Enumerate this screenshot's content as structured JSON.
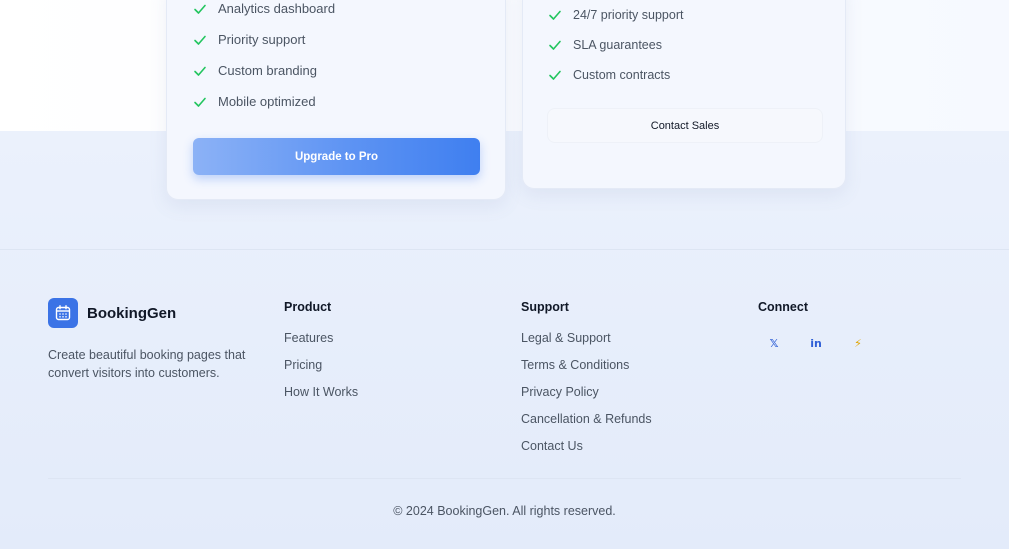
{
  "pricing": {
    "pro": {
      "features": [
        "Analytics dashboard",
        "Priority support",
        "Custom branding",
        "Mobile optimized"
      ],
      "cta_label": "Upgrade to Pro"
    },
    "enterprise": {
      "features": [
        "24/7 priority support",
        "SLA guarantees",
        "Custom contracts"
      ],
      "cta_label": "Contact Sales"
    }
  },
  "footer": {
    "brand_name": "BookingGen",
    "tagline": "Create beautiful booking pages that convert visitors into customers.",
    "product": {
      "title": "Product",
      "links": [
        "Features",
        "Pricing",
        "How It Works"
      ]
    },
    "support": {
      "title": "Support",
      "links": [
        "Legal & Support",
        "Terms & Conditions",
        "Privacy Policy",
        "Cancellation & Refunds",
        "Contact Us"
      ]
    },
    "connect": {
      "title": "Connect",
      "icons": [
        {
          "name": "x-twitter-icon",
          "glyph": "𝕏",
          "color": "#2f5fd6"
        },
        {
          "name": "linkedin-icon",
          "glyph": "in",
          "color": "#2f5fd6"
        },
        {
          "name": "lightning-icon",
          "glyph": "⚡",
          "color": "#e0a400"
        }
      ]
    },
    "copyright": "© 2024 BookingGen. All rights reserved."
  },
  "colors": {
    "accent": "#3b73e6",
    "check": "#22c55e"
  }
}
